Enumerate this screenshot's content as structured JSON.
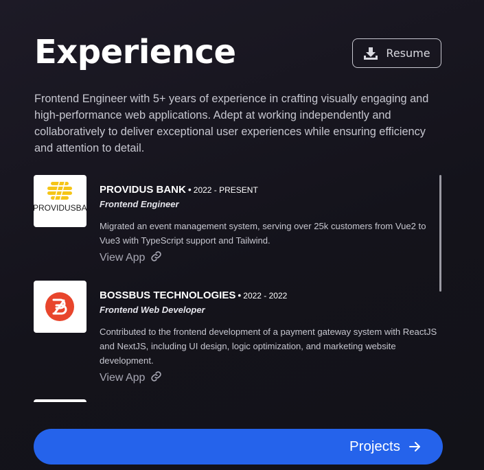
{
  "header": {
    "title": "Experience",
    "resume_label": "Resume",
    "resume_icon": "download-icon"
  },
  "intro": "Frontend Engineer with 5+ years of experience in crafting visually engaging and high-performance web applications. Adept at working independently and collaboratively to deliver exceptional user experiences while ensuring efficiency and attention to detail.",
  "experiences": [
    {
      "company": "PROVIDUS BANK",
      "period": "2022 - PRESENT",
      "role": "Frontend Engineer",
      "description": "Migrated an event management system, serving over 25k customers from Vue2 to Vue3 with TypeScript support and Tailwind.",
      "link_label": "View App",
      "logo_text": "PROVIDUSBANK",
      "logo_color": "#f5c518"
    },
    {
      "company": "BOSSBUS TECHNOLOGIES",
      "period": "2022 - 2022",
      "role": "Frontend Web Developer",
      "description": "Contributed to the frontend development of a payment gateway system with ReactJS and NextJS, including UI design, logic optimization, and marketing website development.",
      "link_label": "View App",
      "logo_color": "#e8452c"
    }
  ],
  "footer": {
    "projects_label": "Projects",
    "projects_icon": "arrow-right-icon",
    "accent_color": "#2563eb"
  }
}
